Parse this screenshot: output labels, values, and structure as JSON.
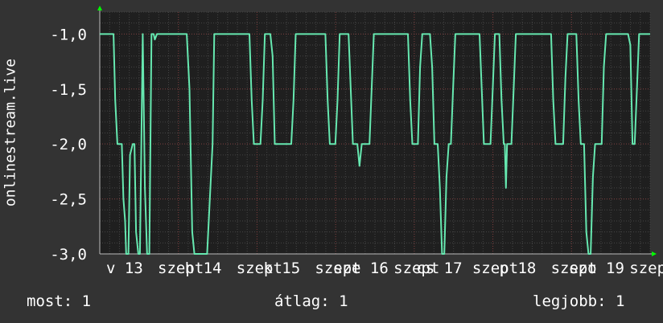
{
  "chart_data": {
    "type": "line",
    "ylabel": "onlinestream.live",
    "ylim": [
      -3.0,
      -0.8
    ],
    "y_ticks": [
      "-1,0",
      "-1,5",
      "-2,0",
      "-2,5",
      "-3,0"
    ],
    "y_tick_values": [
      -1.0,
      -1.5,
      -2.0,
      -2.5,
      -3.0
    ],
    "x_tick_labels": [
      "v 13",
      "szept",
      "h 14",
      "szept",
      "k 15",
      "szept",
      "sze 16",
      "szept",
      "cs 17",
      "szept",
      "p 18",
      "szept",
      "szo 19",
      "szept"
    ],
    "grid": true,
    "series": [
      {
        "color": "#66e8b0",
        "points": [
          [
            0.0,
            -1.0
          ],
          [
            0.025,
            -1.0
          ],
          [
            0.028,
            -1.6
          ],
          [
            0.032,
            -2.0
          ],
          [
            0.04,
            -2.0
          ],
          [
            0.043,
            -2.5
          ],
          [
            0.046,
            -2.7
          ],
          [
            0.048,
            -3.0
          ],
          [
            0.052,
            -3.0
          ],
          [
            0.055,
            -2.1
          ],
          [
            0.06,
            -2.0
          ],
          [
            0.063,
            -2.0
          ],
          [
            0.066,
            -2.8
          ],
          [
            0.07,
            -3.0
          ],
          [
            0.073,
            -3.0
          ],
          [
            0.078,
            -1.0
          ],
          [
            0.082,
            -2.4
          ],
          [
            0.086,
            -3.0
          ],
          [
            0.09,
            -3.0
          ],
          [
            0.094,
            -1.0
          ],
          [
            0.098,
            -1.0
          ],
          [
            0.1,
            -1.05
          ],
          [
            0.104,
            -1.0
          ],
          [
            0.158,
            -1.0
          ],
          [
            0.163,
            -1.5
          ],
          [
            0.168,
            -2.8
          ],
          [
            0.172,
            -3.0
          ],
          [
            0.195,
            -3.0
          ],
          [
            0.2,
            -2.5
          ],
          [
            0.205,
            -2.0
          ],
          [
            0.208,
            -1.0
          ],
          [
            0.272,
            -1.0
          ],
          [
            0.276,
            -1.6
          ],
          [
            0.28,
            -2.0
          ],
          [
            0.292,
            -2.0
          ],
          [
            0.296,
            -1.6
          ],
          [
            0.3,
            -1.0
          ],
          [
            0.31,
            -1.0
          ],
          [
            0.314,
            -1.2
          ],
          [
            0.318,
            -2.0
          ],
          [
            0.348,
            -2.0
          ],
          [
            0.352,
            -1.6
          ],
          [
            0.356,
            -1.0
          ],
          [
            0.41,
            -1.0
          ],
          [
            0.414,
            -1.6
          ],
          [
            0.418,
            -2.0
          ],
          [
            0.428,
            -2.0
          ],
          [
            0.432,
            -1.6
          ],
          [
            0.436,
            -1.0
          ],
          [
            0.452,
            -1.0
          ],
          [
            0.456,
            -1.5
          ],
          [
            0.46,
            -2.0
          ],
          [
            0.468,
            -2.0
          ],
          [
            0.472,
            -2.2
          ],
          [
            0.476,
            -2.0
          ],
          [
            0.49,
            -2.0
          ],
          [
            0.494,
            -1.5
          ],
          [
            0.498,
            -1.0
          ],
          [
            0.56,
            -1.0
          ],
          [
            0.564,
            -1.6
          ],
          [
            0.568,
            -2.0
          ],
          [
            0.578,
            -2.0
          ],
          [
            0.582,
            -1.3
          ],
          [
            0.586,
            -1.0
          ],
          [
            0.6,
            -1.0
          ],
          [
            0.604,
            -1.3
          ],
          [
            0.608,
            -2.0
          ],
          [
            0.614,
            -2.0
          ],
          [
            0.618,
            -2.4
          ],
          [
            0.622,
            -3.0
          ],
          [
            0.626,
            -3.0
          ],
          [
            0.63,
            -2.3
          ],
          [
            0.634,
            -2.0
          ],
          [
            0.638,
            -2.0
          ],
          [
            0.642,
            -1.5
          ],
          [
            0.646,
            -1.0
          ],
          [
            0.69,
            -1.0
          ],
          [
            0.694,
            -1.5
          ],
          [
            0.698,
            -2.0
          ],
          [
            0.71,
            -2.0
          ],
          [
            0.714,
            -1.5
          ],
          [
            0.718,
            -1.0
          ],
          [
            0.726,
            -1.0
          ],
          [
            0.73,
            -1.6
          ],
          [
            0.734,
            -2.0
          ],
          [
            0.736,
            -2.0
          ],
          [
            0.738,
            -2.4
          ],
          [
            0.74,
            -2.0
          ],
          [
            0.748,
            -2.0
          ],
          [
            0.752,
            -1.5
          ],
          [
            0.756,
            -1.0
          ],
          [
            0.82,
            -1.0
          ],
          [
            0.824,
            -1.6
          ],
          [
            0.828,
            -2.0
          ],
          [
            0.842,
            -2.0
          ],
          [
            0.846,
            -1.4
          ],
          [
            0.85,
            -1.0
          ],
          [
            0.866,
            -1.0
          ],
          [
            0.87,
            -1.6
          ],
          [
            0.874,
            -2.0
          ],
          [
            0.88,
            -2.0
          ],
          [
            0.884,
            -2.8
          ],
          [
            0.888,
            -3.0
          ],
          [
            0.892,
            -3.0
          ],
          [
            0.896,
            -2.3
          ],
          [
            0.9,
            -2.0
          ],
          [
            0.912,
            -2.0
          ],
          [
            0.916,
            -1.3
          ],
          [
            0.92,
            -1.0
          ],
          [
            0.96,
            -1.0
          ],
          [
            0.964,
            -1.1
          ],
          [
            0.968,
            -2.0
          ],
          [
            0.972,
            -2.0
          ],
          [
            0.976,
            -1.5
          ],
          [
            0.98,
            -1.0
          ],
          [
            1.0,
            -1.0
          ]
        ]
      }
    ]
  },
  "footer": {
    "now": "most: 1",
    "avg": "átlag: 1",
    "best": "legjobb: 1"
  },
  "colors": {
    "background": "#333333",
    "plot_bg": "#1f1f1f",
    "grid_major": "#7a3a3a",
    "grid_minor": "#444444",
    "line": "#66e8b0",
    "arrow": "#00ff00"
  }
}
